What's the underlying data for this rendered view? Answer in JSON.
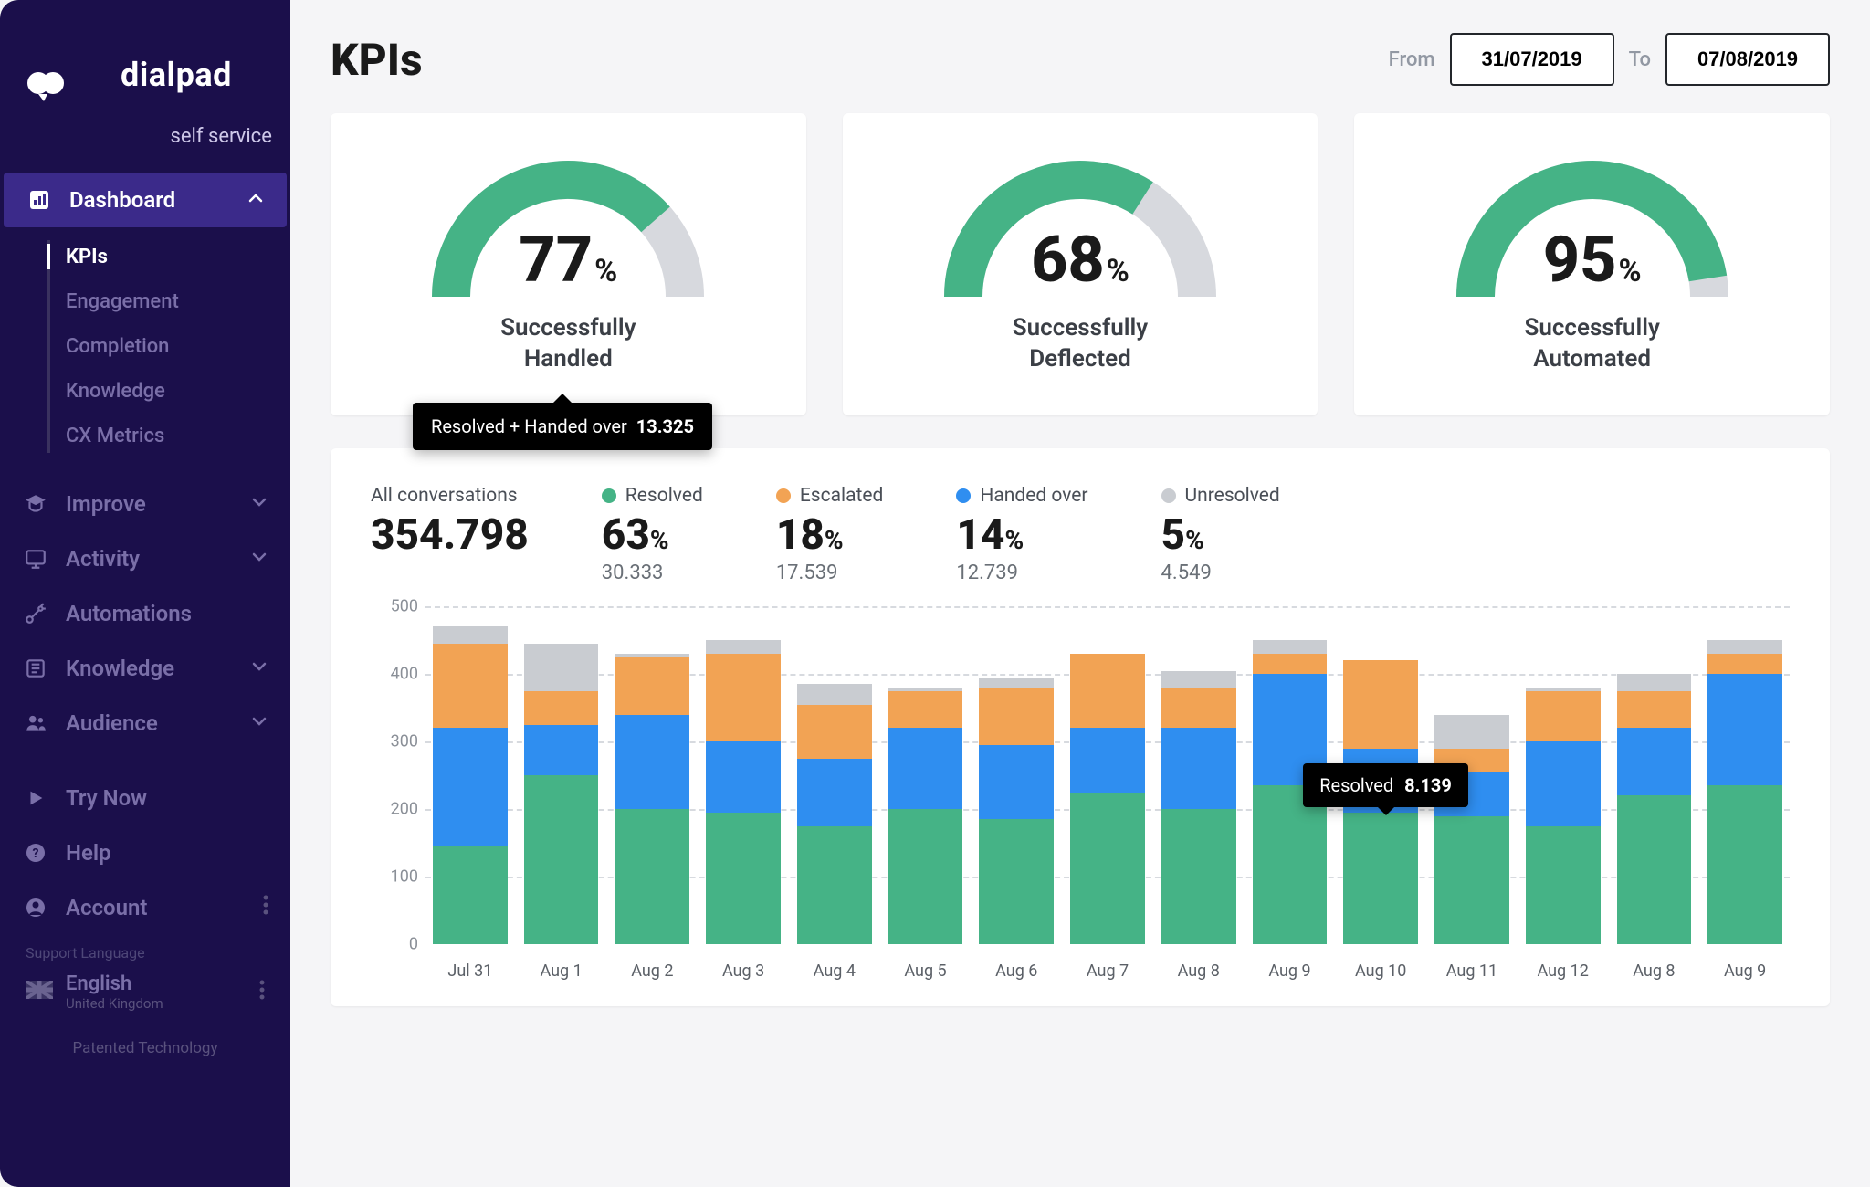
{
  "brand": {
    "name": "dialpad",
    "sub": "self service"
  },
  "sidebar": {
    "dashboard": {
      "label": "Dashboard",
      "items": [
        "KPIs",
        "Engagement",
        "Completion",
        "Knowledge",
        "CX Metrics"
      ],
      "active_index": 0
    },
    "secondary": [
      {
        "label": "Improve",
        "icon": "graduation-icon",
        "chev": true
      },
      {
        "label": "Activity",
        "icon": "monitor-icon",
        "chev": true
      },
      {
        "label": "Automations",
        "icon": "robot-arm-icon",
        "chev": false
      },
      {
        "label": "Knowledge",
        "icon": "book-icon",
        "chev": true
      },
      {
        "label": "Audience",
        "icon": "people-icon",
        "chev": true
      }
    ],
    "utility": [
      {
        "label": "Try Now",
        "icon": "play-icon"
      },
      {
        "label": "Help",
        "icon": "help-icon"
      },
      {
        "label": "Account",
        "icon": "account-icon",
        "dots": true
      }
    ],
    "support_label": "Support Language",
    "language": {
      "name": "English",
      "region": "United Kingdom"
    },
    "patented": "Patented Technology"
  },
  "page": {
    "title": "KPIs",
    "from_label": "From",
    "to_label": "To",
    "date_from": "31/07/2019",
    "date_to": "07/08/2019"
  },
  "gauges": [
    {
      "value": 77,
      "percent": "%",
      "label_line1": "Successfully",
      "label_line2": "Handled",
      "tooltip": {
        "text": "Resolved + Handed over",
        "value": "13.325"
      }
    },
    {
      "value": 68,
      "percent": "%",
      "label_line1": "Successfully",
      "label_line2": "Deflected"
    },
    {
      "value": 95,
      "percent": "%",
      "label_line1": "Successfully",
      "label_line2": "Automated"
    }
  ],
  "stats": {
    "all_label": "All conversations",
    "all_value": "354.798",
    "breakdown": [
      {
        "label": "Resolved",
        "color": "#45b386",
        "pct": "63",
        "value": "30.333"
      },
      {
        "label": "Escalated",
        "color": "#f2a354",
        "pct": "18",
        "value": "17.539"
      },
      {
        "label": "Handed over",
        "color": "#2f8ef0",
        "pct": "14",
        "value": "12.739"
      },
      {
        "label": "Unresolved",
        "color": "#c9ccd1",
        "pct": "5",
        "value": "4.549"
      }
    ]
  },
  "chart_data": {
    "type": "bar",
    "stacked": true,
    "ylabel": "",
    "ylim": [
      0,
      500
    ],
    "yticks": [
      0,
      100,
      200,
      300,
      400,
      500
    ],
    "categories": [
      "Jul 31",
      "Aug 1",
      "Aug 2",
      "Aug 3",
      "Aug 4",
      "Aug 5",
      "Aug 6",
      "Aug 7",
      "Aug 8",
      "Aug 9",
      "Aug 10",
      "Aug 11",
      "Aug 12",
      "Aug 8",
      "Aug 9"
    ],
    "series": [
      {
        "name": "Resolved",
        "color": "#45b386",
        "values": [
          145,
          250,
          200,
          195,
          175,
          200,
          185,
          225,
          200,
          235,
          195,
          190,
          175,
          220,
          235
        ]
      },
      {
        "name": "Handed over",
        "color": "#2f8ef0",
        "values": [
          175,
          75,
          140,
          105,
          100,
          120,
          110,
          95,
          120,
          165,
          95,
          65,
          125,
          100,
          165
        ]
      },
      {
        "name": "Escalated",
        "color": "#f2a354",
        "values": [
          125,
          50,
          85,
          130,
          80,
          55,
          85,
          110,
          60,
          30,
          130,
          35,
          75,
          55,
          30
        ]
      },
      {
        "name": "Unresolved",
        "color": "#c9ccd1",
        "values": [
          25,
          70,
          5,
          20,
          30,
          5,
          15,
          0,
          25,
          20,
          0,
          50,
          5,
          25,
          20
        ]
      }
    ],
    "tooltip": {
      "label": "Resolved",
      "value": "8.139",
      "col_index": 10
    }
  }
}
